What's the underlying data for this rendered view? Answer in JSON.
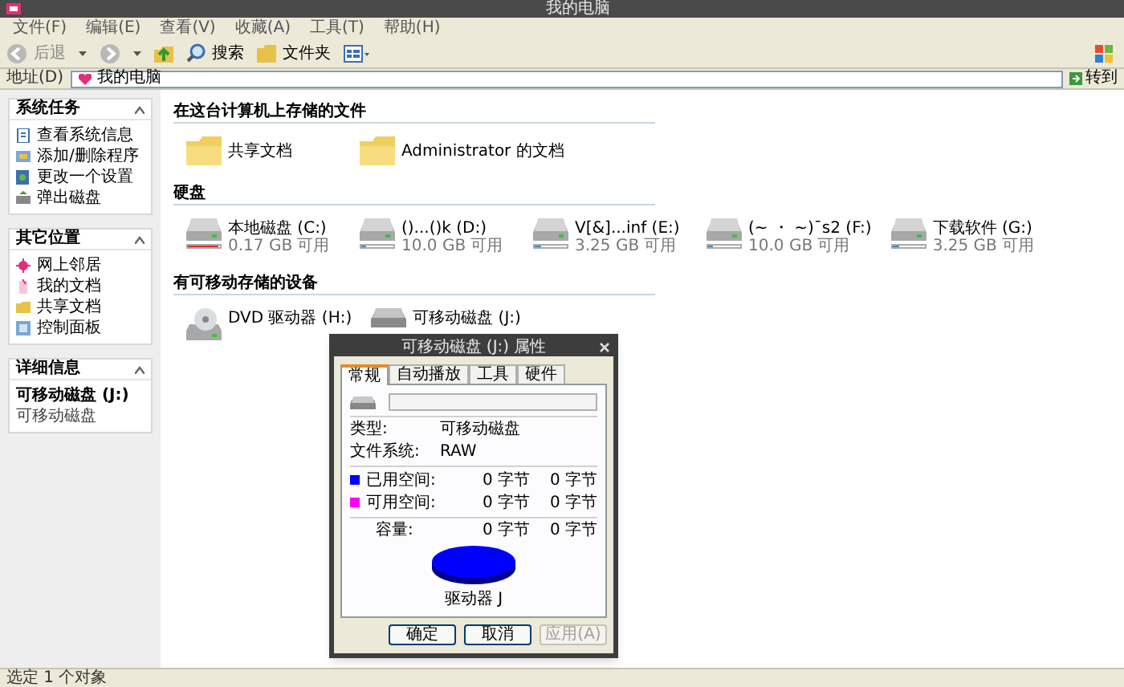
{
  "window": {
    "title": "我的电脑"
  },
  "menu": [
    "文件(F)",
    "编辑(E)",
    "查看(V)",
    "收藏(A)",
    "工具(T)",
    "帮助(H)"
  ],
  "toolbar": {
    "back": "后退",
    "search": "搜索",
    "folders": "文件夹"
  },
  "address": {
    "label": "地址(D)",
    "value": "我的电脑",
    "go": "转到"
  },
  "sidebar": [
    {
      "title": "系统任务",
      "items": [
        "查看系统信息",
        "添加/删除程序",
        "更改一个设置",
        "弹出磁盘"
      ]
    },
    {
      "title": "其它位置",
      "items": [
        "网上邻居",
        "我的文档",
        "共享文档",
        "控制面板"
      ]
    },
    {
      "title": "详细信息",
      "detail_name": "可移动磁盘 (J:)",
      "detail_type": "可移动磁盘"
    }
  ],
  "sections": [
    {
      "title": "在这台计算机上存储的文件",
      "items": [
        {
          "kind": "folder",
          "label": "共享文档"
        },
        {
          "kind": "folder",
          "label": "Administrator 的文档"
        }
      ]
    },
    {
      "title": "硬盘",
      "items": [
        {
          "kind": "drive",
          "label": "本地磁盘 (C:)",
          "free": "0.17 GB 可用",
          "level": 0.95,
          "color": "#d83030"
        },
        {
          "kind": "drive",
          "label": "()...()k (D:)",
          "free": "10.0 GB 可用",
          "level": 0.15,
          "color": "#3c8fd8"
        },
        {
          "kind": "drive",
          "label": "V[&]...inf (E:)",
          "free": "3.25 GB 可用",
          "level": 0.2,
          "color": "#3c8fd8"
        },
        {
          "kind": "drive",
          "label": "(~ ・ ~)ˉs2 (F:)",
          "free": "10.0 GB 可用",
          "level": 0.15,
          "color": "#3c8fd8"
        },
        {
          "kind": "drive",
          "label": "下载软件 (G:)",
          "free": "3.25 GB 可用",
          "level": 0.2,
          "color": "#3c8fd8"
        }
      ]
    },
    {
      "title": "有可移动存储的设备",
      "items": [
        {
          "kind": "dvd",
          "label": "DVD 驱动器 (H:)"
        },
        {
          "kind": "removable",
          "label": "可移动磁盘 (J:)"
        }
      ]
    }
  ],
  "dialog": {
    "title": "可移动磁盘 (J:) 属性",
    "tabs": [
      {
        "label": "常规",
        "selected": true
      },
      {
        "label": "自动播放",
        "selected": false
      },
      {
        "label": "工具",
        "selected": false
      },
      {
        "label": "硬件",
        "selected": false
      }
    ],
    "type_label": "类型:",
    "type_value": "可移动磁盘",
    "fs_label": "文件系统:",
    "fs_value": "RAW",
    "space": [
      {
        "label": "已用空间:",
        "bytes": "0 字节",
        "size": "0 字节",
        "color": "#0000ff"
      },
      {
        "label": "可用空间:",
        "bytes": "0 字节",
        "size": "0 字节",
        "color": "#ff00ff"
      }
    ],
    "capacity": {
      "label": "容量:",
      "bytes": "0 字节",
      "size": "0 字节"
    },
    "drive_caption": "驱动器 J",
    "buttons": [
      {
        "label": "确定",
        "disabled": false
      },
      {
        "label": "取消",
        "disabled": false
      },
      {
        "label": "应用(A)",
        "disabled": true
      }
    ]
  },
  "status_bar": "选定 1 个对象"
}
